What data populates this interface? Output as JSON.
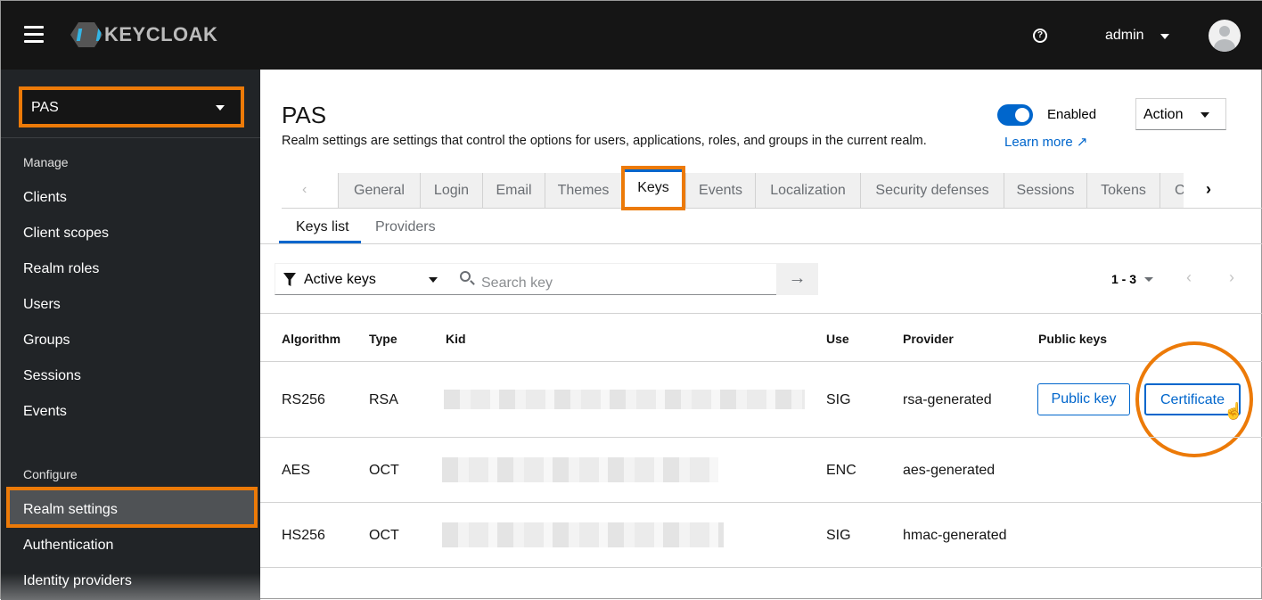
{
  "header": {
    "brand": "KEYCLOAK",
    "help_icon": "?",
    "user": "admin"
  },
  "sidebar": {
    "realm": "PAS",
    "manage_label": "Manage",
    "manage_items": [
      "Clients",
      "Client scopes",
      "Realm roles",
      "Users",
      "Groups",
      "Sessions",
      "Events"
    ],
    "configure_label": "Configure",
    "configure_items": [
      "Realm settings",
      "Authentication",
      "Identity providers"
    ]
  },
  "page": {
    "title": "PAS",
    "description": "Realm settings are settings that control the options for users, applications, roles, and groups in the current realm.",
    "learn_more": "Learn more",
    "enabled_label": "Enabled",
    "enabled": true,
    "action_label": "Action"
  },
  "tabs": [
    "General",
    "Login",
    "Email",
    "Themes",
    "Keys",
    "Events",
    "Localization",
    "Security defenses",
    "Sessions",
    "Tokens",
    "C"
  ],
  "active_tab": "Keys",
  "subtabs": [
    "Keys list",
    "Providers"
  ],
  "toolbar": {
    "filter": "Active keys",
    "search_placeholder": "Search key",
    "pagination": "1 - 3"
  },
  "table": {
    "headers": [
      "Algorithm",
      "Type",
      "Kid",
      "Use",
      "Provider",
      "Public keys"
    ],
    "rows": [
      {
        "algorithm": "RS256",
        "type": "RSA",
        "use": "SIG",
        "provider": "rsa-generated",
        "public_key_button": "Public key",
        "certificate_button": "Certificate"
      },
      {
        "algorithm": "AES",
        "type": "OCT",
        "use": "ENC",
        "provider": "aes-generated"
      },
      {
        "algorithm": "HS256",
        "type": "OCT",
        "use": "SIG",
        "provider": "hmac-generated"
      }
    ]
  },
  "colors": {
    "accent": "#0066cc",
    "highlight": "#ec7a08",
    "topbar": "#151515",
    "sidebar": "#212427"
  }
}
